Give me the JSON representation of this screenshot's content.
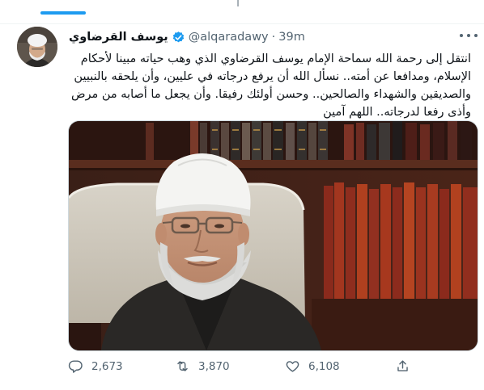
{
  "tweet": {
    "author_name": "يوسف القرضاوي",
    "handle": "@alqaradawy",
    "separator": "·",
    "time": "39m",
    "text_lines": [
      "انتقل إلى رحمة الله سماحة الإمام يوسف القرضاوي  الذي وهب حياته مبينا لأحكام",
      "الإسلام، ومدافعا عن أمته.. نسأل الله أن يرفع درجاته في عليين، وأن يلحقه بالنبيين",
      "والصديقين والشهداء والصالحين.. وحسن أولئك رفيقا. وأن يجعل ما أصابه من مرض",
      "وأذى رفعا لدرجاته.. اللهم آمين"
    ]
  },
  "actions": {
    "reply_count": "2,673",
    "retweet_count": "3,870",
    "like_count": "6,108"
  },
  "icons": [
    "reply-icon",
    "retweet-icon",
    "like-icon",
    "share-icon",
    "verified-badge-icon",
    "more-options-icon"
  ],
  "colors": {
    "accent": "#1d9bf0",
    "muted": "#536471",
    "text": "#0f1419"
  }
}
